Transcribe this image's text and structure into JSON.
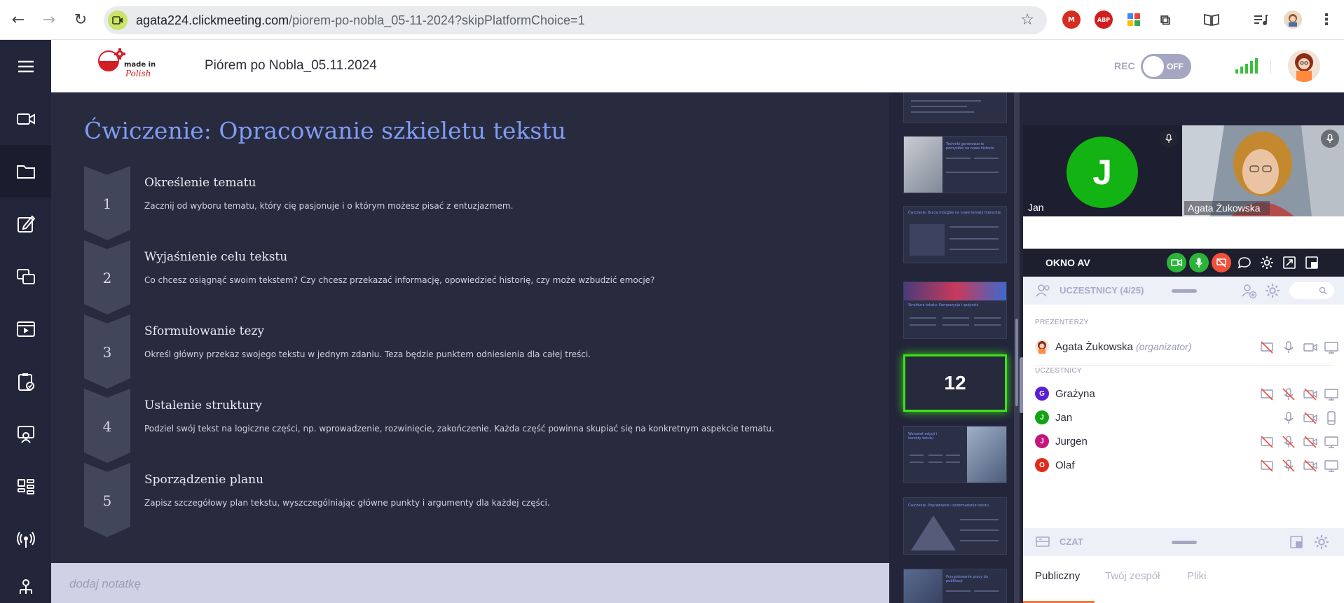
{
  "browser": {
    "url_host": "agata224.clickmeeting.com",
    "url_path": "/piorem-po-nobla_05-11-2024?skipPlatformChoice=1"
  },
  "header": {
    "event_title": "Piórem po Nobla_05.11.2024",
    "rec_label": "REC",
    "rec_state": "OFF",
    "logo_text": "made in Polish"
  },
  "slide": {
    "title": "Ćwiczenie: Opracowanie szkieletu tekstu",
    "steps": [
      {
        "num": "1",
        "title": "Określenie tematu",
        "text": "Zacznij od wyboru tematu, który cię pasjonuje i o którym możesz pisać z entuzjazmem."
      },
      {
        "num": "2",
        "title": "Wyjaśnienie celu tekstu",
        "text": "Co chcesz osiągnąć swoim tekstem? Czy chcesz przekazać informację, opowiedzieć historię, czy może wzbudzić emocje?"
      },
      {
        "num": "3",
        "title": "Sformułowanie tezy",
        "text": "Określ główny przekaz swojego tekstu w jednym zdaniu. Teza będzie punktem odniesienia dla całej treści."
      },
      {
        "num": "4",
        "title": "Ustalenie struktury",
        "text": "Podziel swój tekst na logiczne części, np. wprowadzenie, rozwinięcie, zakończenie. Każda część powinna skupiać się na konkretnym aspekcie tematu."
      },
      {
        "num": "5",
        "title": "Sporządzenie planu",
        "text": "Zapisz szczegółowy plan tekstu, wyszczególniając główne punkty i argumenty dla każdej części."
      }
    ]
  },
  "notes": {
    "placeholder": "dodaj notatkę"
  },
  "thumbnails": {
    "active_number": "12",
    "titles": [
      "Techniki generowania pomysłów na nowe historie",
      "Ćwiczenie: Burza mózgów na nowe tematy literackie",
      "Struktura tekstu: Kompozycja i spójność",
      "Warsztat edycji i korekty tekstu",
      "Ćwiczenie: Poprawianie i dodomadanie tekstu",
      "Przygotowanie pracy do publikacji"
    ]
  },
  "av": {
    "window_label": "OKNO AV",
    "tiles": [
      {
        "name": "Jan",
        "initial": "J"
      },
      {
        "name": "Agata Żukowska"
      }
    ]
  },
  "participants": {
    "header": "UCZESTNICY (4/25)",
    "presenters_label": "PREZENTERZY",
    "attendees_label": "UCZESTNICY",
    "presenters": [
      {
        "name": "Agata Żukowska",
        "role": "(organizator)"
      }
    ],
    "attendees": [
      {
        "initial": "G",
        "name": "Grażyna",
        "color": "#5a1fd1"
      },
      {
        "initial": "J",
        "name": "Jan",
        "color": "#12a312"
      },
      {
        "initial": "J",
        "name": "Jurgen",
        "color": "#c2187a"
      },
      {
        "initial": "O",
        "name": "Olaf",
        "color": "#e02b1a"
      }
    ]
  },
  "chat": {
    "header": "CZAT",
    "tabs": [
      "Publiczny",
      "Twój zespół",
      "Pliki"
    ]
  },
  "colors": {
    "accent": "#7f9cf5",
    "sidebar": "#23253a",
    "highlight": "#3ee019",
    "chat_active": "#f27a3a"
  }
}
